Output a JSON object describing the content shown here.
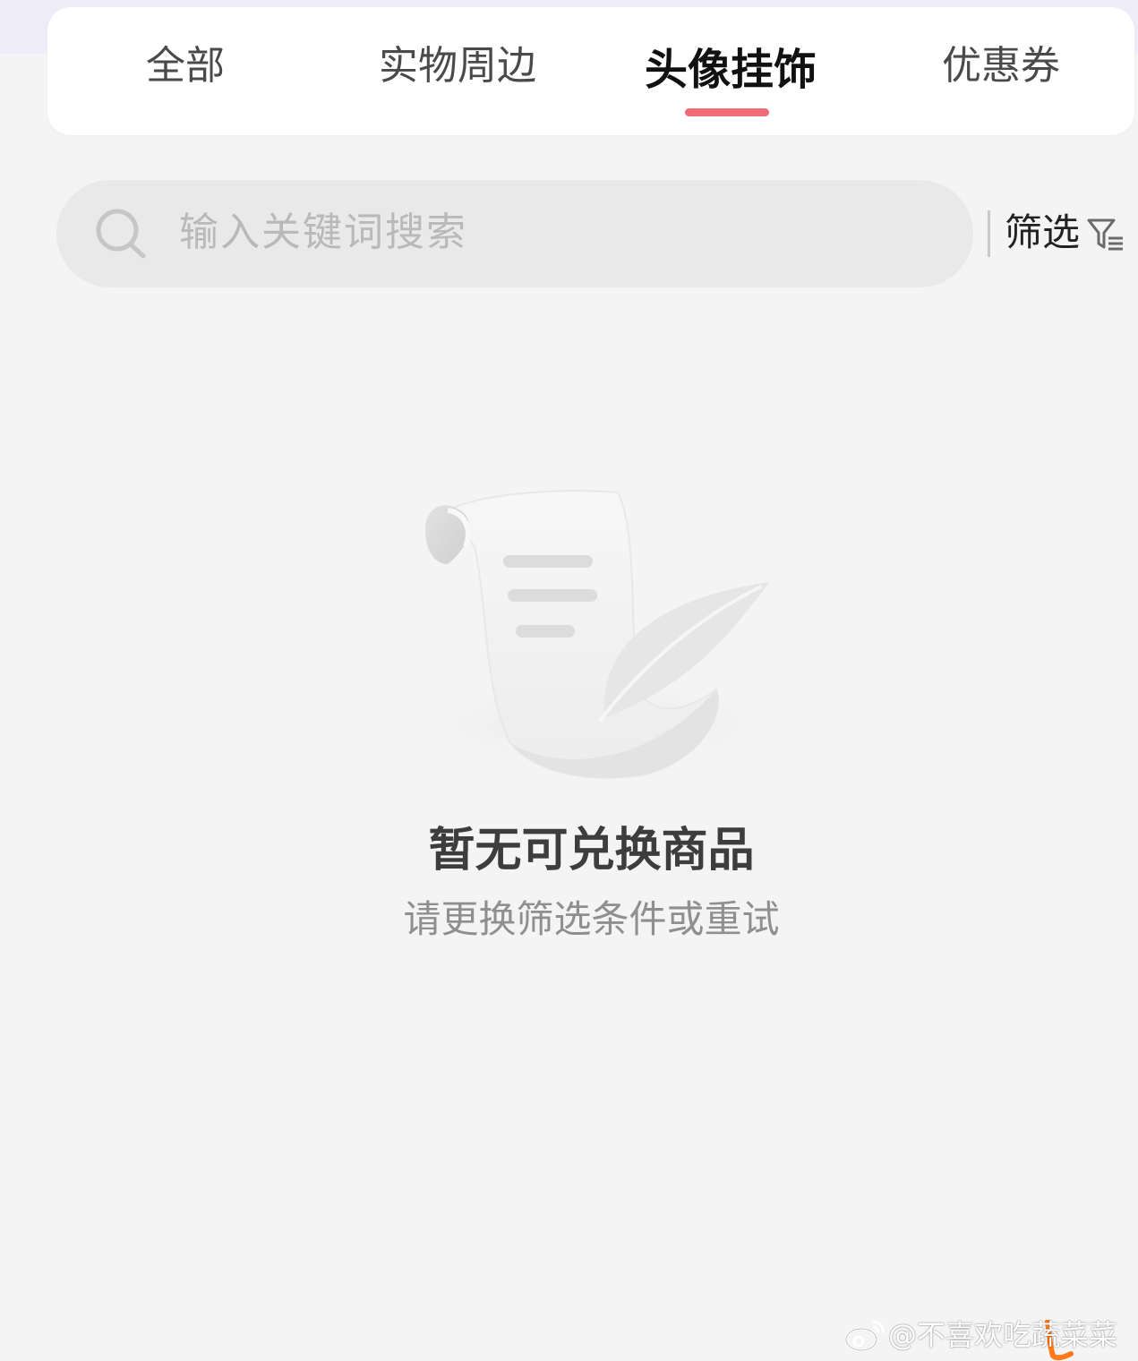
{
  "tabs": [
    {
      "label": "全部",
      "active": false
    },
    {
      "label": "实物周边",
      "active": false
    },
    {
      "label": "头像挂饰",
      "active": true
    },
    {
      "label": "优惠券",
      "active": false
    }
  ],
  "search": {
    "placeholder": "输入关键词搜索"
  },
  "filter": {
    "label": "筛选"
  },
  "empty_state": {
    "title": "暂无可兑换商品",
    "subtitle": "请更换筛选条件或重试"
  },
  "watermark": {
    "text": "@不喜欢吃蔬菜菜"
  },
  "colors": {
    "accent_underline": "#ef6b75",
    "page_background": "#f4f4f4",
    "search_background": "#e9e9e9"
  },
  "icons": {
    "search": "search-icon",
    "filter": "filter-icon",
    "empty": "scroll-feather-illustration",
    "watermark": "weibo-icon"
  }
}
